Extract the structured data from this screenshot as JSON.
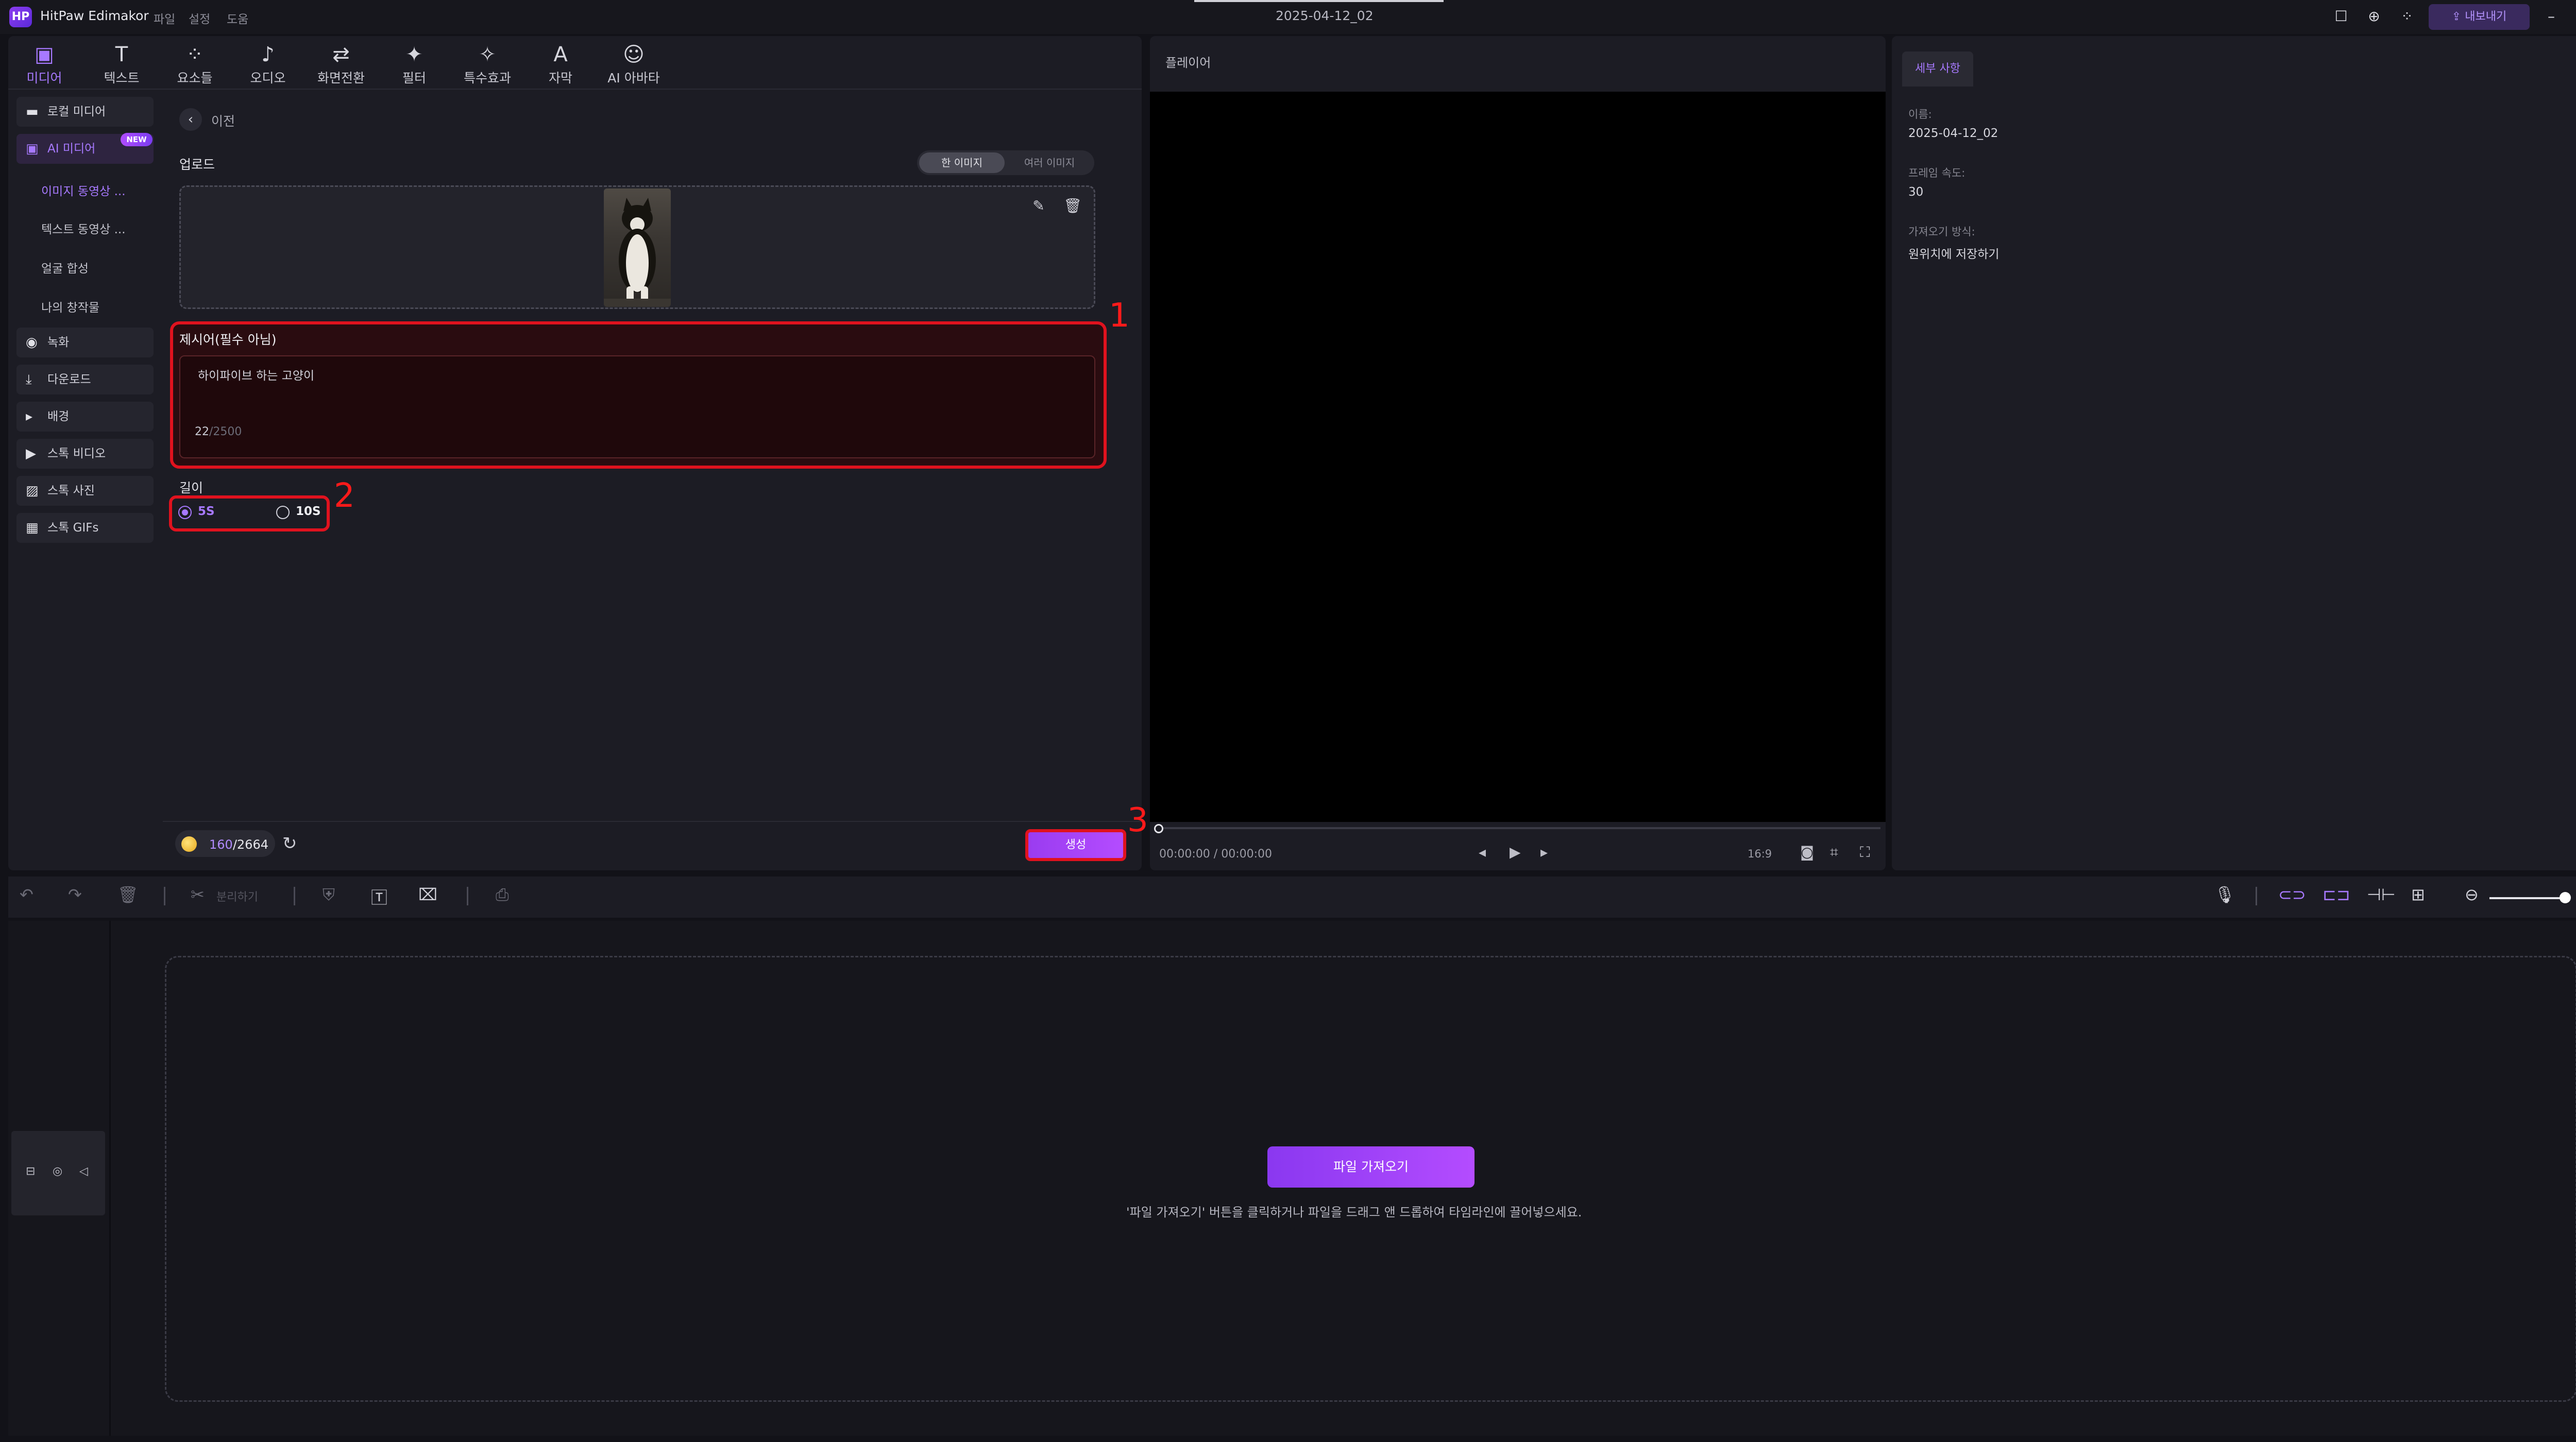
{
  "app": {
    "logo": "HP",
    "title": "HitPaw Edimakor",
    "menu": [
      "파일",
      "설정",
      "도움"
    ],
    "doc_title": "2025-04-12_02",
    "export_label": "내보내기"
  },
  "window_icons": [
    "feedback-icon",
    "download-icon",
    "apps-icon",
    "minimize-icon",
    "restore-icon",
    "close-icon"
  ],
  "toolbar": {
    "tabs": [
      {
        "label": "미디어",
        "icon": "media-icon",
        "active": true
      },
      {
        "label": "텍스트",
        "icon": "text-icon"
      },
      {
        "label": "요소들",
        "icon": "elements-icon"
      },
      {
        "label": "오디오",
        "icon": "audio-icon"
      },
      {
        "label": "화면전환",
        "icon": "transition-icon"
      },
      {
        "label": "필터",
        "icon": "filter-icon"
      },
      {
        "label": "특수효과",
        "icon": "effects-icon"
      },
      {
        "label": "자막",
        "icon": "subtitle-icon"
      },
      {
        "label": "AI 아바타",
        "icon": "ai-avatar-icon"
      }
    ]
  },
  "sidebar": {
    "items": [
      {
        "label": "로컬 미디어",
        "icon": "folder-icon"
      },
      {
        "label": "AI 미디어",
        "icon": "ai-media-icon",
        "badge": "NEW",
        "active": true
      },
      {
        "label": "녹화",
        "icon": "record-icon"
      },
      {
        "label": "다운로드",
        "icon": "download-icon"
      },
      {
        "label": "배경",
        "icon": "caret-right-icon"
      },
      {
        "label": "스톡 비디오",
        "icon": "video-icon"
      },
      {
        "label": "스톡 사진",
        "icon": "photo-icon"
      },
      {
        "label": "스톡 GIFs",
        "icon": "gif-icon"
      }
    ],
    "sub_items": [
      {
        "label": "이미지 동영상 ...",
        "active": true
      },
      {
        "label": "텍스트 동영상 ..."
      },
      {
        "label": "얼굴 합성"
      },
      {
        "label": "나의 창작물"
      }
    ]
  },
  "content": {
    "back_label": "이전",
    "upload_label": "업로드",
    "modes": [
      "한 이미지",
      "여러 이미지"
    ],
    "prompt_label": "제시어(필수 아님)",
    "prompt_value": "하이파이브 하는 고양이",
    "prompt_count": "22",
    "prompt_max": "/2500",
    "length_label": "길이",
    "length_options": [
      "5S",
      "10S"
    ],
    "length_selected": "5S",
    "credits_used": "160",
    "credits_total": "/2664",
    "generate_label": "생성",
    "annotations": [
      "1",
      "2",
      "3"
    ]
  },
  "player": {
    "title": "플레이어",
    "time": "00:00:00 / 00:00:00",
    "aspect": "16:9"
  },
  "details": {
    "tab": "세부 사항",
    "fields": [
      {
        "label": "이름:",
        "value": "2025-04-12_02"
      },
      {
        "label": "프레임 속도:",
        "value": "30"
      },
      {
        "label": "가져오기 방식:",
        "value": "원위치에 저장하기"
      }
    ]
  },
  "timeline": {
    "split_label": "분리하기",
    "import_label": "파일 가져오기",
    "drop_hint": "'파일 가져오기' 버튼을 클릭하거나 파일을 드래그 앤 드롭하여 타임라인에 끌어넣으세요."
  },
  "colors": {
    "accent": "#a779ff",
    "annotation": "#e0121e",
    "button": "#b44cff"
  }
}
